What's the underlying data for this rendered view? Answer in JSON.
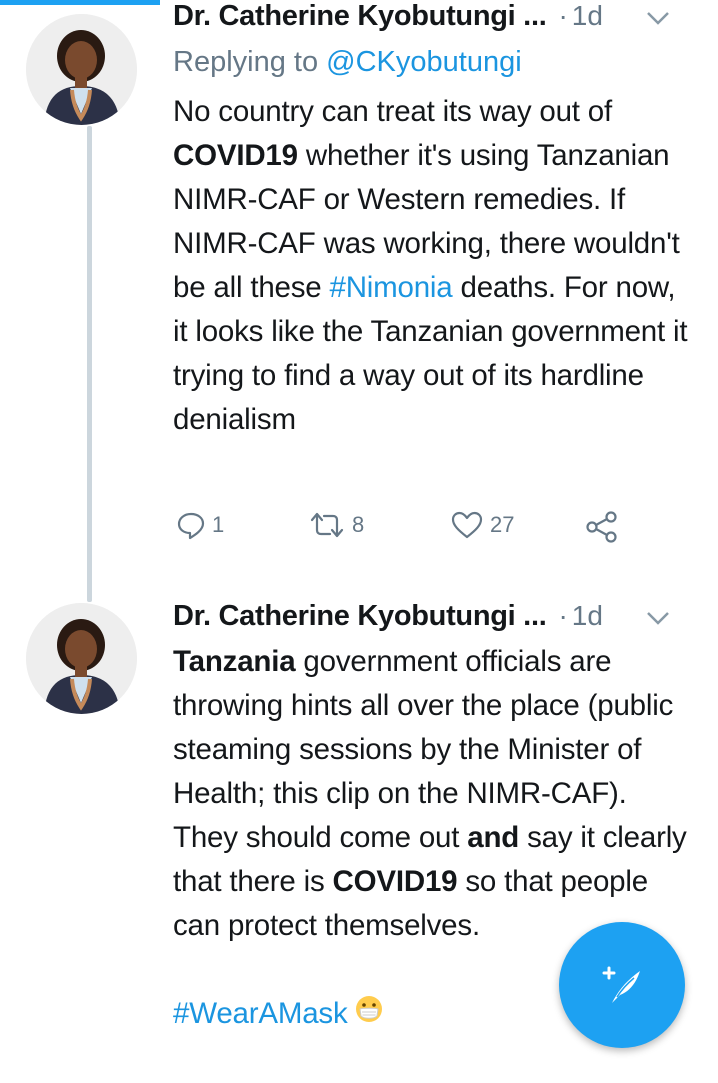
{
  "tweets": [
    {
      "author": "Dr. Catherine Kyobutungi ...",
      "separator": "·",
      "time": "1d",
      "replying_prefix": "Replying to ",
      "replying_handle": "@CKyobutungi",
      "body_segments": [
        {
          "text": "No country can treat its way out of ",
          "style": "plain"
        },
        {
          "text": "COVID19",
          "style": "bold"
        },
        {
          "text": " whether it's using Tanzanian NIMR-CAF or Western remedies. If NIMR-CAF was working, there wouldn't be all these ",
          "style": "plain"
        },
        {
          "text": "#Nimonia",
          "style": "hashtag"
        },
        {
          "text": " deaths. For now, it looks like the Tanzanian government it trying to find a way out of its hardline denialism",
          "style": "plain"
        }
      ],
      "actions": {
        "reply_count": "1",
        "retweet_count": "8",
        "like_count": "27"
      }
    },
    {
      "author": "Dr. Catherine Kyobutungi ...",
      "separator": "·",
      "time": "1d",
      "body_segments": [
        {
          "text": "Tanzania",
          "style": "bold"
        },
        {
          "text": " government officials are throwing hints all over the place (public steaming sessions by the Minister of Health; this clip on the NIMR-CAF). They should come out ",
          "style": "plain"
        },
        {
          "text": "and",
          "style": "bold"
        },
        {
          "text": " say it clearly that there is ",
          "style": "plain"
        },
        {
          "text": "COVID19",
          "style": "bold"
        },
        {
          "text": " so that people can protect themselves.",
          "style": "plain"
        }
      ],
      "hashtag_line": "#WearAMask",
      "emoji": "mask-face-icon"
    }
  ],
  "colors": {
    "accent": "#1da1f2",
    "link": "#1b95e0",
    "muted": "#657786",
    "thread_line": "#ccd6dd"
  },
  "fab": {
    "icon": "compose-tweet-icon"
  }
}
